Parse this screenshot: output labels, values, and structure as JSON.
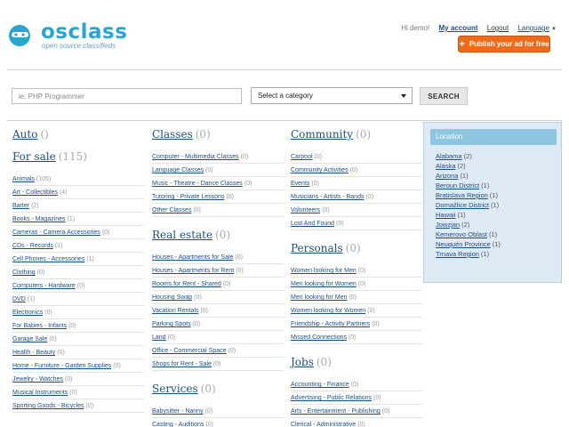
{
  "brand": {
    "name": "osclass",
    "tagline": "open source classifieds"
  },
  "topnav": {
    "greeting": "Hi demo!",
    "my_account": "My account",
    "logout": "Logout",
    "language": "Language"
  },
  "publish_label": "Publish your ad for free",
  "search": {
    "placeholder": "ie. PHP Programmer",
    "category_selected": "Select a category",
    "button": "SEARCH"
  },
  "columns": [
    [
      {
        "title": "Auto",
        "count": "()",
        "subs": []
      },
      {
        "title": "For sale",
        "count": "(115)",
        "subs": [
          {
            "name": "Animals",
            "count": "(105)"
          },
          {
            "name": "Art - Collectibles",
            "count": "(4)"
          },
          {
            "name": "Barter",
            "count": "(2)"
          },
          {
            "name": "Books - Magazines",
            "count": "(1)"
          },
          {
            "name": "Cameras - Camera Accessories",
            "count": "(0)"
          },
          {
            "name": "CDs - Records",
            "count": "(1)"
          },
          {
            "name": "Cell Phones - Accessories",
            "count": "(1)"
          },
          {
            "name": "Clothing",
            "count": "(0)"
          },
          {
            "name": "Computers - Hardware",
            "count": "(0)"
          },
          {
            "name": "DVD",
            "count": "(1)"
          },
          {
            "name": "Electronics",
            "count": "(0)"
          },
          {
            "name": "For Babies - Infants",
            "count": "(0)"
          },
          {
            "name": "Garage Sale",
            "count": "(0)"
          },
          {
            "name": "Health - Beauty",
            "count": "(0)"
          },
          {
            "name": "Home - Furniture - Garden Supplies",
            "count": "(0)"
          },
          {
            "name": "Jewelry - Watches",
            "count": "(0)"
          },
          {
            "name": "Musical Instruments",
            "count": "(0)"
          },
          {
            "name": "Sporting Goods - Bicycles",
            "count": "(0)"
          }
        ]
      }
    ],
    [
      {
        "title": "Classes",
        "count": "(0)",
        "subs": [
          {
            "name": "Computer - Multimedia Classes",
            "count": "(0)"
          },
          {
            "name": "Language Classes",
            "count": "(0)"
          },
          {
            "name": "Music - Theatre - Dance Classes",
            "count": "(0)"
          },
          {
            "name": "Tutoring - Private Lessons",
            "count": "(0)"
          },
          {
            "name": "Other Classes",
            "count": "(0)"
          }
        ]
      },
      {
        "title": "Real estate",
        "count": "(0)",
        "subs": [
          {
            "name": "Houses - Apartments for Sale",
            "count": "(0)"
          },
          {
            "name": "Houses - Apartments for Rent",
            "count": "(0)"
          },
          {
            "name": "Rooms for Rent - Shared",
            "count": "(0)"
          },
          {
            "name": "Housing Swap",
            "count": "(0)"
          },
          {
            "name": "Vacation Rentals",
            "count": "(0)"
          },
          {
            "name": "Parking Spots",
            "count": "(0)"
          },
          {
            "name": "Land",
            "count": "(0)"
          },
          {
            "name": "Office - Commercial Space",
            "count": "(0)"
          },
          {
            "name": "Shops for Rent - Sale",
            "count": "(0)"
          }
        ]
      },
      {
        "title": "Services",
        "count": "(0)",
        "subs": [
          {
            "name": "Babysitter - Nanny",
            "count": "(0)"
          },
          {
            "name": "Casting - Auditions",
            "count": "(0)"
          }
        ]
      }
    ],
    [
      {
        "title": "Community",
        "count": "(0)",
        "subs": [
          {
            "name": "Carpool",
            "count": "(0)"
          },
          {
            "name": "Community Activities",
            "count": "(0)"
          },
          {
            "name": "Events",
            "count": "(0)"
          },
          {
            "name": "Musicians - Artists - Bands",
            "count": "(0)"
          },
          {
            "name": "Volunteers",
            "count": "(0)"
          },
          {
            "name": "Lost And Found",
            "count": "(0)"
          }
        ]
      },
      {
        "title": "Personals",
        "count": "(0)",
        "subs": [
          {
            "name": "Women looking for Men",
            "count": "(0)"
          },
          {
            "name": "Men looking for Women",
            "count": "(0)"
          },
          {
            "name": "Men looking for Men",
            "count": "(0)"
          },
          {
            "name": "Women looking for Women",
            "count": "(0)"
          },
          {
            "name": "Friendship - Activity Partners",
            "count": "(0)"
          },
          {
            "name": "Missed Connections",
            "count": "(0)"
          }
        ]
      },
      {
        "title": "Jobs",
        "count": "(0)",
        "subs": [
          {
            "name": "Accounting - Finance",
            "count": "(0)"
          },
          {
            "name": "Advertising - Public Relations",
            "count": "(0)"
          },
          {
            "name": "Arts - Entertainment - Publishing",
            "count": "(0)"
          },
          {
            "name": "Clerical - Administrative",
            "count": "(0)"
          }
        ]
      }
    ]
  ],
  "location": {
    "title": "Location",
    "items": [
      {
        "name": "Alabama",
        "count": "(2)"
      },
      {
        "name": "Alaska",
        "count": "(2)"
      },
      {
        "name": "Arizona",
        "count": "(1)"
      },
      {
        "name": "Beroun District",
        "count": "(1)"
      },
      {
        "name": "Bratislava Region",
        "count": "(1)"
      },
      {
        "name": "Domažlice District",
        "count": "(1)"
      },
      {
        "name": "Hawaii",
        "count": "(1)"
      },
      {
        "name": "Jowzjan",
        "count": "(2)"
      },
      {
        "name": "Kemerovo Oblast",
        "count": "(1)"
      },
      {
        "name": "Neuquén Province",
        "count": "(1)"
      },
      {
        "name": "Trnava Region",
        "count": "(1)"
      }
    ]
  },
  "colors": {
    "brand": "#2aa5cf",
    "publish": "#ef6a1a",
    "link": "#1a4f8a",
    "location_bg": "#deeaf4"
  }
}
